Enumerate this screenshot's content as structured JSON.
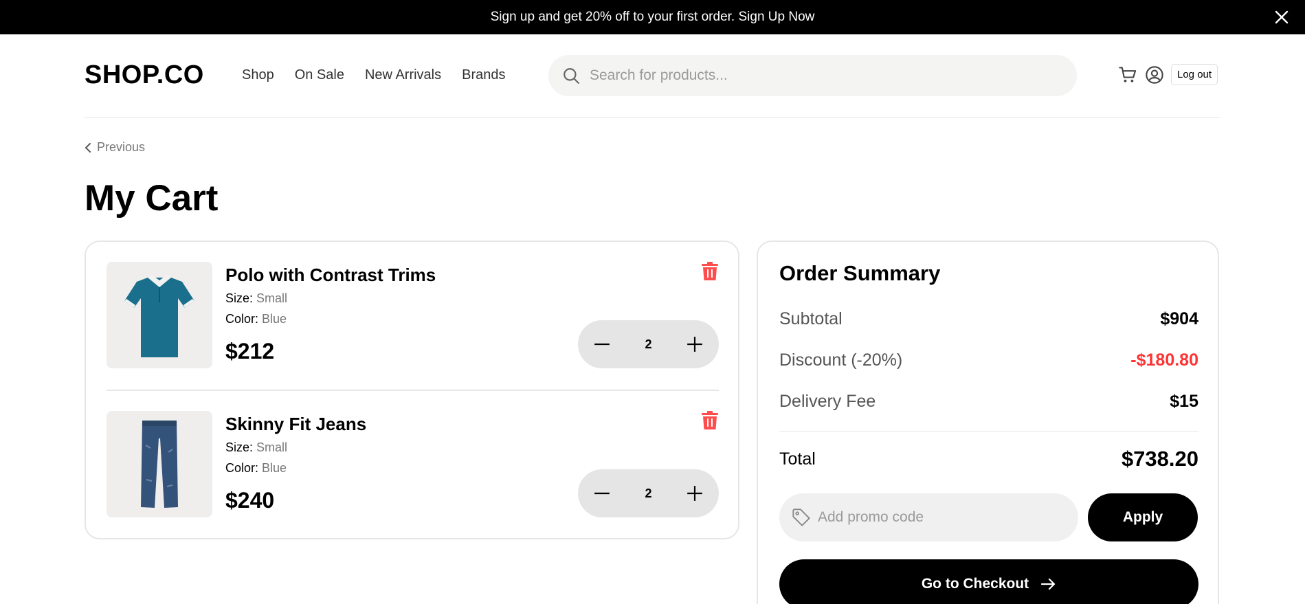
{
  "banner": {
    "text": "Sign up and get 20% off to your first order. Sign Up Now",
    "close_icon": "close-icon"
  },
  "header": {
    "logo": "SHOP.CO",
    "nav": [
      "Shop",
      "On Sale",
      "New Arrivals",
      "Brands"
    ],
    "search_placeholder": "Search for products...",
    "logout_label": "Log out",
    "icons": [
      "search-icon",
      "cart-icon",
      "user-icon"
    ]
  },
  "breadcrumb": {
    "previous_label": "Previous"
  },
  "page_title": "My Cart",
  "cart": {
    "items": [
      {
        "name": "Polo with Contrast Trims",
        "size_label": "Size:",
        "size": "Small",
        "color_label": "Color:",
        "color": "Blue",
        "price": "$212",
        "quantity": "2",
        "image": "polo-shirt-image"
      },
      {
        "name": "Skinny Fit Jeans",
        "size_label": "Size:",
        "size": "Small",
        "color_label": "Color:",
        "color": "Blue",
        "price": "$240",
        "quantity": "2",
        "image": "jeans-image"
      }
    ]
  },
  "summary": {
    "title": "Order Summary",
    "subtotal_label": "Subtotal",
    "subtotal": "$904",
    "discount_label": "Discount (-20%)",
    "discount": "-$180.80",
    "delivery_label": "Delivery Fee",
    "delivery": "$15",
    "total_label": "Total",
    "total": "$738.20",
    "promo_placeholder": "Add promo code",
    "apply_label": "Apply",
    "checkout_label": "Go to Checkout"
  },
  "colors": {
    "accent": "#000000",
    "discount": "#ff3333",
    "delete": "#ff3333",
    "muted": "#777777"
  }
}
